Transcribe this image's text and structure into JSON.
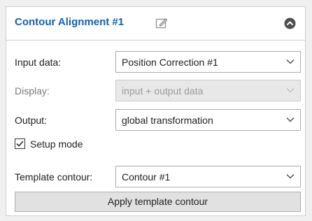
{
  "panel": {
    "title": "Contour Alignment #1",
    "edit_icon": "pencil-edit-icon",
    "collapse_icon": "chevron-up-circle-icon"
  },
  "fields": {
    "input_data": {
      "label": "Input data:",
      "value": "Position Correction #1",
      "enabled": true
    },
    "display": {
      "label": "Display:",
      "value": "input + output data",
      "enabled": false
    },
    "output": {
      "label": "Output:",
      "value": "global transformation",
      "enabled": true
    },
    "template_contour": {
      "label": "Template contour:",
      "value": "Contour #1",
      "enabled": true
    }
  },
  "setup_mode": {
    "label": "Setup mode",
    "checked": true
  },
  "apply_button": {
    "label": "Apply template contour"
  },
  "colors": {
    "title_blue": "#1a5fa8",
    "disabled_text": "#9b9b9b",
    "button_face": "#e1e1e1"
  }
}
